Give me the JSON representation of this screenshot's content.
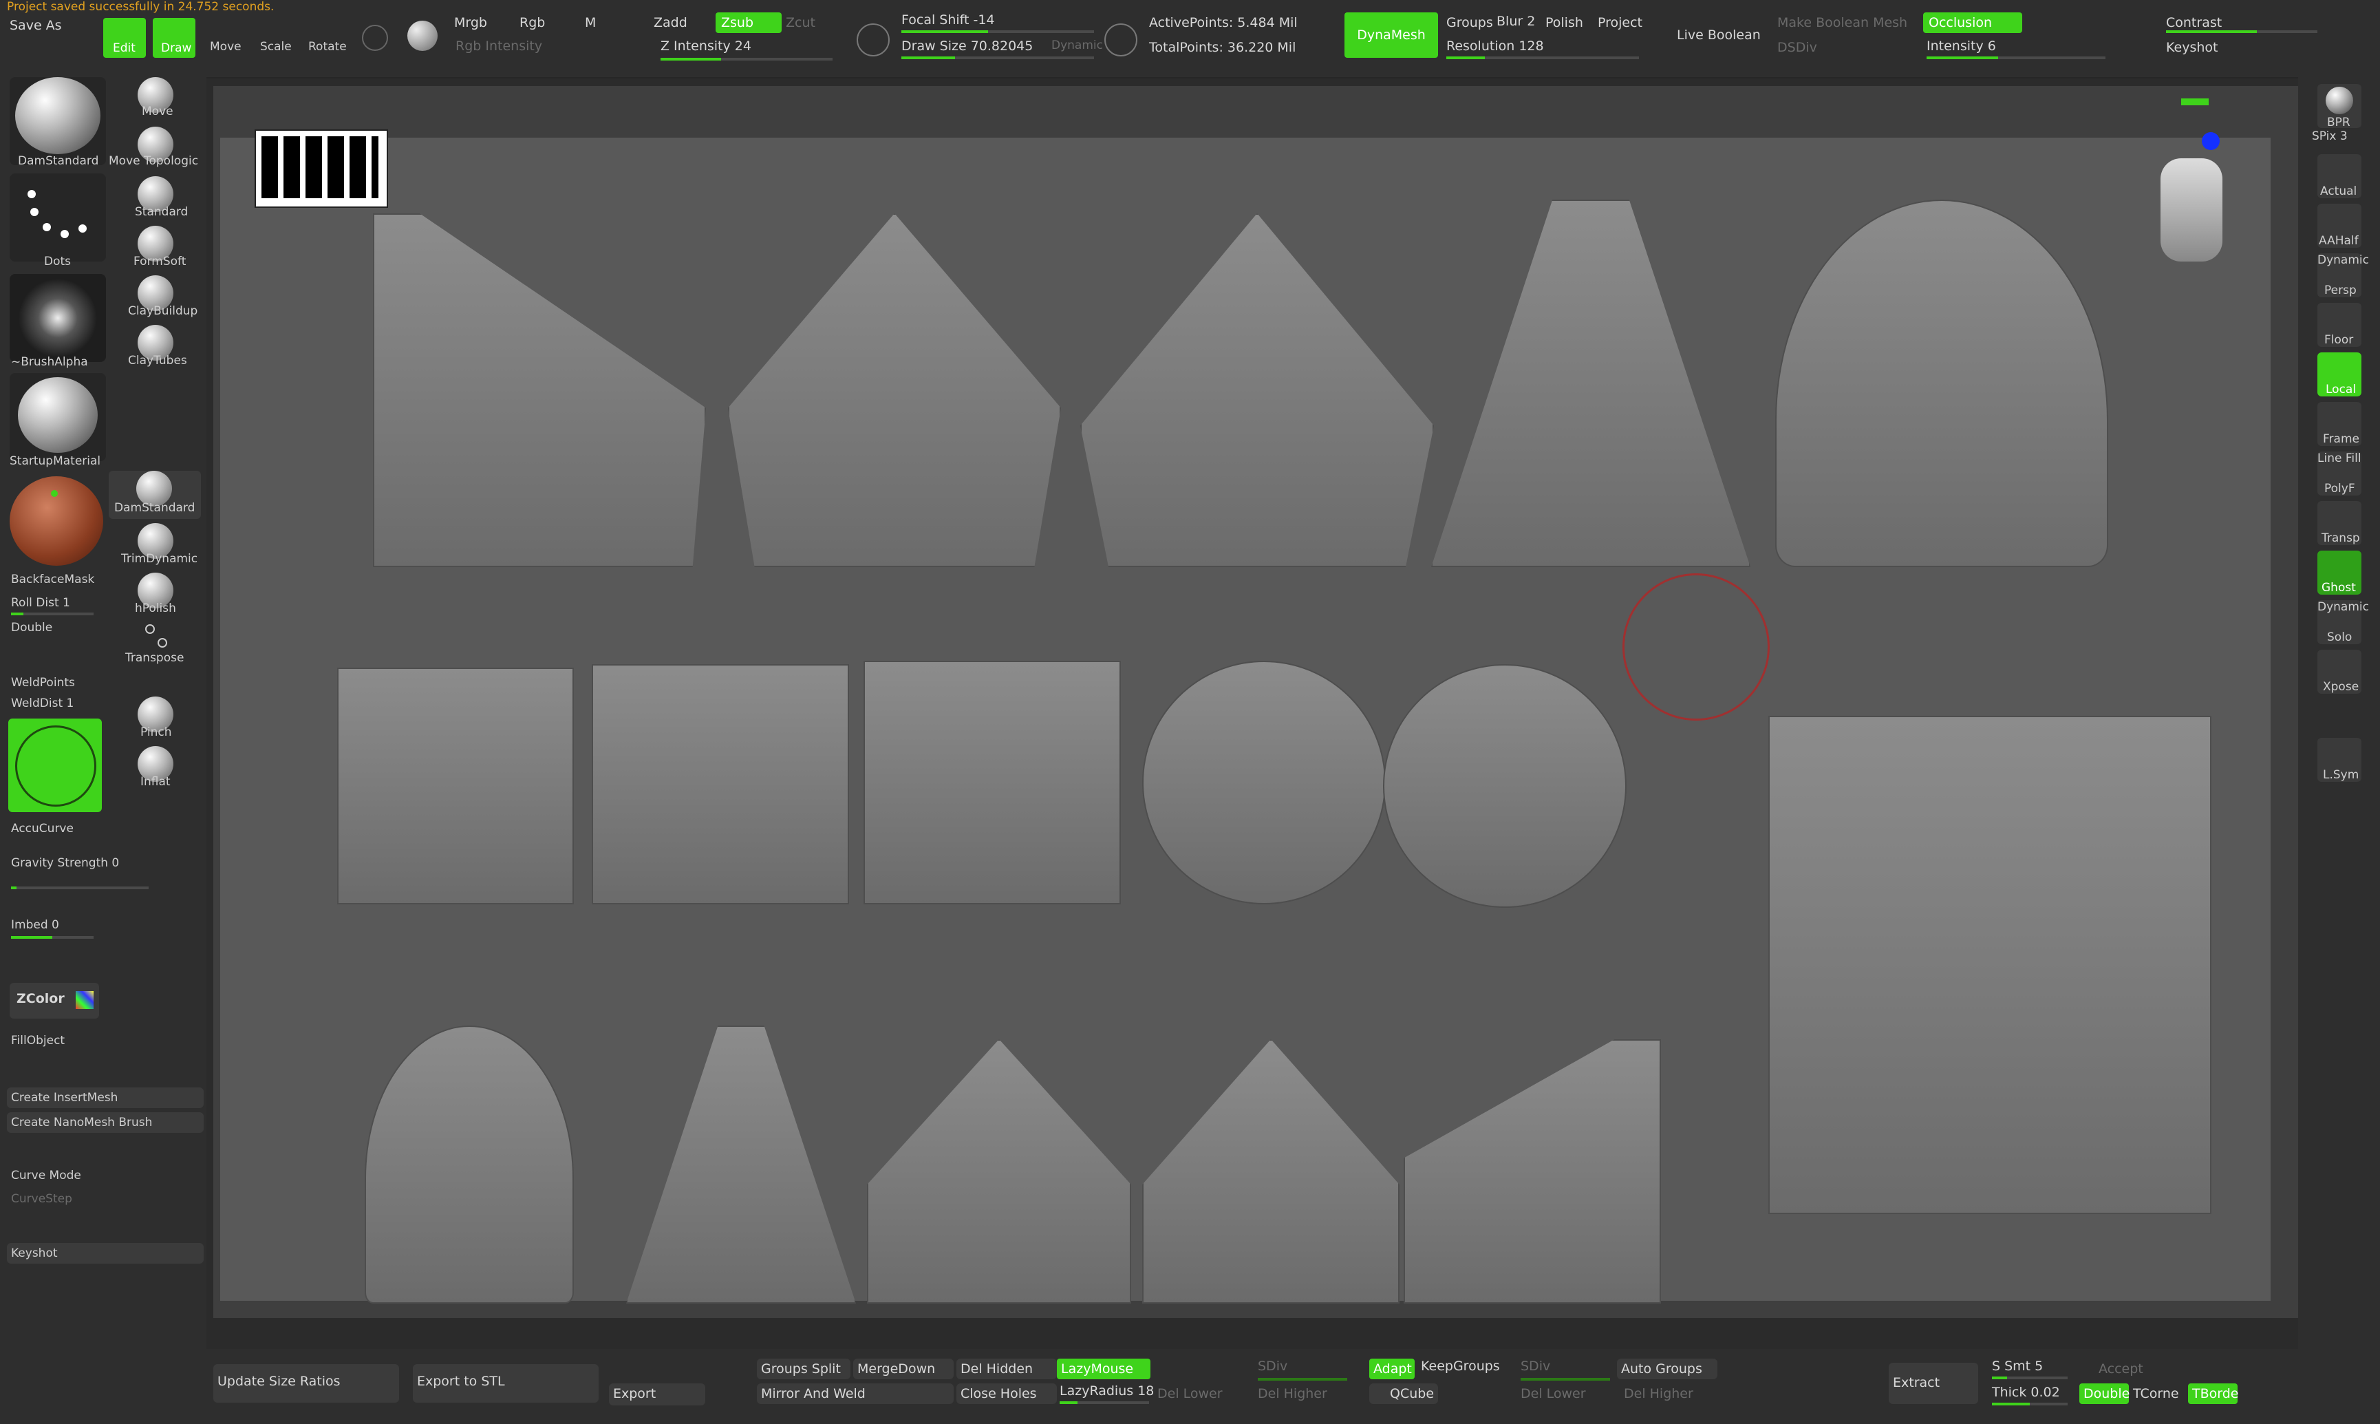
{
  "app": {
    "status_line": "Project saved successfully in 24.752 seconds."
  },
  "toolbar": {
    "save_as": "Save As",
    "tools": [
      {
        "label": "Edit"
      },
      {
        "label": "Draw"
      },
      {
        "label": "Move"
      },
      {
        "label": "Scale"
      },
      {
        "label": "Rotate"
      }
    ],
    "mrgb": "Mrgb",
    "rgb": "Rgb",
    "m": "M",
    "rgb_intensity": "Rgb Intensity",
    "zadd": "Zadd",
    "zsub": "Zsub",
    "zcut": "Zcut",
    "z_intensity": "Z Intensity 24",
    "focal_shift": "Focal Shift -14",
    "draw_size": "Draw Size 70.82045",
    "dynamic": "Dynamic",
    "active_points": "ActivePoints: 5.484 Mil",
    "total_points": "TotalPoints: 36.220 Mil",
    "dynamesh": "DynaMesh",
    "groups": "Groups",
    "blur": "Blur 2",
    "polish": "Polish",
    "project": "Project",
    "resolution": "Resolution 128",
    "live_boolean": "Live Boolean",
    "make_boolean_mesh": "Make Boolean Mesh",
    "dsdiv": "DSDiv",
    "occlusion": "Occlusion",
    "intensity": "Intensity 6",
    "contrast": "Contrast",
    "keyshot": "Keyshot"
  },
  "left": {
    "dam_standard": "DamStandard",
    "dots": "Dots",
    "brush_alpha": "~BrushAlpha",
    "startup_material": "StartupMaterial",
    "brushes_col": [
      "Move",
      "Move Topologic",
      "Standard",
      "FormSoft",
      "ClayBuildup",
      "ClayTubes"
    ],
    "brushes_col2": [
      "DamStandard",
      "TrimDynamic",
      "hPolish",
      "Transpose",
      "Pinch",
      "Inflat"
    ],
    "backface_mask": "BackfaceMask",
    "roll_dist": "Roll Dist 1",
    "double": "Double",
    "weld_points": "WeldPoints",
    "weld_dist": "WeldDist 1",
    "accucurve": "AccuCurve",
    "gravity": "Gravity Strength 0",
    "imbed": "Imbed 0",
    "zcolor": "ZColor",
    "fill_object": "FillObject",
    "create_insertmesh": "Create InsertMesh",
    "create_nanomesh": "Create NanoMesh Brush",
    "curve_mode": "Curve Mode",
    "curve_step": "CurveStep",
    "keyshot": "Keyshot"
  },
  "bottom": {
    "update_size_ratios": "Update Size Ratios",
    "export_stl": "Export to STL",
    "export": "Export",
    "groups_split": "Groups Split",
    "merge_down": "MergeDown",
    "del_hidden": "Del Hidden",
    "lazymouse": "LazyMouse",
    "sdiv": "SDiv",
    "adapt": "Adapt",
    "keep_groups": "KeepGroups",
    "sdiv2": "SDiv",
    "auto_groups": "Auto Groups",
    "mirror_weld": "Mirror And Weld",
    "close_holes": "Close Holes",
    "lazy_radius": "LazyRadius 18",
    "del_lower": "Del Lower",
    "del_higher": "Del Higher",
    "qcube": "QCube",
    "del_lower2": "Del Lower",
    "del_higher2": "Del Higher",
    "extract": "Extract",
    "s_smt": "S Smt 5",
    "accept": "Accept",
    "thick": "Thick 0.02",
    "double": "Double",
    "tcorne": "TCorne",
    "tborde": "TBorde"
  },
  "right": {
    "labels": [
      "BPR",
      "SPix 3",
      "Actual",
      "AAHalf",
      "Dynamic",
      "Persp",
      "Floor",
      "Local",
      "Frame",
      "Line Fill",
      "PolyF",
      "Transp",
      "Ghost",
      "Dynamic",
      "Solo",
      "Xpose",
      "L.Sym"
    ]
  },
  "colors": {
    "accent": "#3fd31b",
    "canvas": "#595959",
    "panel": "#2e2e2e",
    "status": "#e0a020"
  }
}
